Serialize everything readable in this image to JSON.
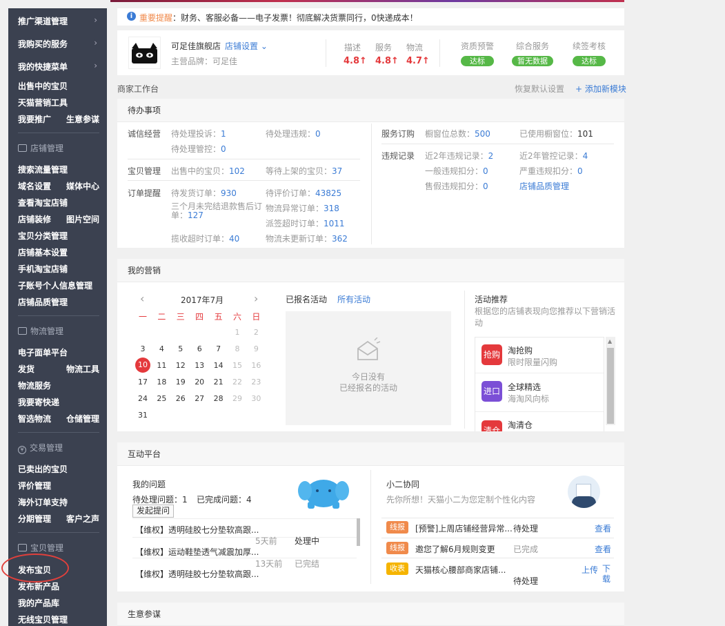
{
  "sidebar": {
    "top_items": [
      "推广渠道管理",
      "我购买的服务",
      "我的快捷菜单"
    ],
    "quick": [
      "出售中的宝贝",
      "天猫营销工具",
      "我要推广",
      "生意参谋"
    ],
    "sections": [
      {
        "title": "店铺管理",
        "items": [
          "搜索流量管理",
          "域名设置",
          "媒体中心",
          "查看淘宝店铺",
          "店铺装修",
          "图片空间",
          "宝贝分类管理",
          "店铺基本设置",
          "手机淘宝店铺",
          "子账号个人信息管理",
          "店铺品质管理"
        ]
      },
      {
        "title": "物流管理",
        "items": [
          "电子面单平台",
          "发货",
          "物流工具",
          "物流服务",
          "我要寄快递",
          "智选物流",
          "仓储管理"
        ]
      },
      {
        "title": "交易管理",
        "items": [
          "已卖出的宝贝",
          "评价管理",
          "海外订单支持",
          "分期管理",
          "客户之声"
        ]
      },
      {
        "title": "宝贝管理",
        "items": [
          "发布宝贝",
          "发布新产品",
          "我的产品库",
          "无线宝贝管理"
        ]
      }
    ],
    "arrow": "›",
    "trade_icon": "¥"
  },
  "notice": {
    "label": "重要提醒",
    "text": "：财务、客服必备——电子发票！彻底解决货票同行，0快递成本！"
  },
  "store": {
    "name": "可足佳旗舰店",
    "settings": "店铺设置",
    "brand": "主营品牌：可足佳",
    "metrics": [
      {
        "label": "描述",
        "value": "4.8↑"
      },
      {
        "label": "服务",
        "value": "4.8↑"
      },
      {
        "label": "物流",
        "value": "4.7↑"
      }
    ],
    "checks": [
      {
        "label": "资质预警",
        "badge": "达标"
      },
      {
        "label": "综合服务",
        "badge": "暂无数据"
      },
      {
        "label": "续签考核",
        "badge": "达标"
      }
    ]
  },
  "workbench": {
    "title": "商家工作台",
    "restore": "恢复默认设置",
    "add": "+ 添加新模块"
  },
  "todo": {
    "title": "待办事项",
    "integrity": {
      "label": "诚信经营",
      "complaints": "待处理投诉：",
      "complaints_n": "1",
      "violations": "待处理违规：",
      "violations_n": "0",
      "control": "待处理管控：",
      "control_n": "0"
    },
    "items": {
      "label": "宝贝管理",
      "selling": "出售中的宝贝：",
      "selling_n": "102",
      "waiting": "等待上架的宝贝：",
      "waiting_n": "37"
    },
    "orders": {
      "label": "订单提醒",
      "ship": "待发货订单：",
      "ship_n": "930",
      "review": "待评价订单：",
      "review_n": "43825",
      "refund": "三个月未完结退款售后订单：",
      "refund_n": "127",
      "abnormal": "物流异常订单：",
      "abnormal_n": "318",
      "timeout": "派签超时订单：",
      "timeout_n": "1011",
      "pickup": "揽收超时订单：",
      "pickup_n": "40",
      "noupdate": "物流未更新订单：",
      "noupdate_n": "362"
    },
    "service": {
      "label": "服务订购",
      "total": "橱窗位总数：",
      "total_n": "500",
      "used": "已使用橱窗位：",
      "used_n": "101"
    },
    "violation": {
      "label": "违规记录",
      "v2y": "近2年违规记录：",
      "v2y_n": "2",
      "c2y": "近2年管控记录：",
      "c2y_n": "4",
      "general": "一般违规扣分：",
      "general_n": "0",
      "serious": "严重违规扣分：",
      "serious_n": "0",
      "fake": "售假违规扣分：",
      "fake_n": "0",
      "quality": "店铺品质管理"
    }
  },
  "marketing": {
    "title": "我的营销",
    "month": "2017年7月",
    "prev": "‹",
    "next": "›",
    "weekdays": [
      "一",
      "二",
      "三",
      "四",
      "五",
      "六",
      "日"
    ],
    "days": [
      "1",
      "2",
      "3",
      "4",
      "5",
      "6",
      "7",
      "8",
      "9",
      "10",
      "11",
      "12",
      "13",
      "14",
      "15",
      "16",
      "17",
      "18",
      "19",
      "20",
      "21",
      "22",
      "23",
      "24",
      "25",
      "26",
      "27",
      "28",
      "29",
      "30",
      "31"
    ],
    "today": "10",
    "signed": "已报名活动",
    "all": "所有活动",
    "empty1": "今日没有",
    "empty2": "已经报名的活动",
    "rec_title": "活动推荐",
    "rec_desc": "根据您的店铺表现向您推荐以下营销活动",
    "rec": [
      {
        "icon": "抢购",
        "name": "淘抢购",
        "desc": "限时限量闪购",
        "color": "#e4393c"
      },
      {
        "icon": "进口",
        "name": "全球精选",
        "desc": "海淘风向标",
        "color": "#7b4fd6"
      },
      {
        "icon": "清仓",
        "name": "淘清仓",
        "desc": "",
        "color": "#e4393c"
      }
    ]
  },
  "interact": {
    "title": "互动平台",
    "my_q": "我的问题",
    "pending": "待处理问题：1",
    "done": "已完成问题：4",
    "ask": "发起提问",
    "questions": [
      {
        "text": "【维权】透明硅胶七分垫软高跟...",
        "time": "5天前",
        "status": "处理中"
      },
      {
        "text": "【维权】运动鞋垫透气减震加厚...",
        "time": "13天前",
        "status": "已完结"
      },
      {
        "text": "【维权】透明硅胶七分垫软高跟...",
        "time": "",
        "status": ""
      }
    ],
    "xiaoer": "小二协同",
    "xiaoer_desc": "先你所想！天猫小二为您定制个性化内容",
    "tasks": [
      {
        "tag": "线报",
        "text": "[预警]上周店铺经营异常...",
        "status": "待处理",
        "action": "查看",
        "color": "#f08a4b"
      },
      {
        "tag": "线报",
        "text": "邀您了解6月规则变更",
        "status": "已完成",
        "action": "查看",
        "color": "#f08a4b"
      },
      {
        "tag": "收表",
        "text": "天猫核心腰部商家店铺...",
        "status": "待处理",
        "action": "上传",
        "action2": "下载",
        "color": "#f5b400"
      }
    ]
  },
  "biz": {
    "title": "生意参谋"
  }
}
